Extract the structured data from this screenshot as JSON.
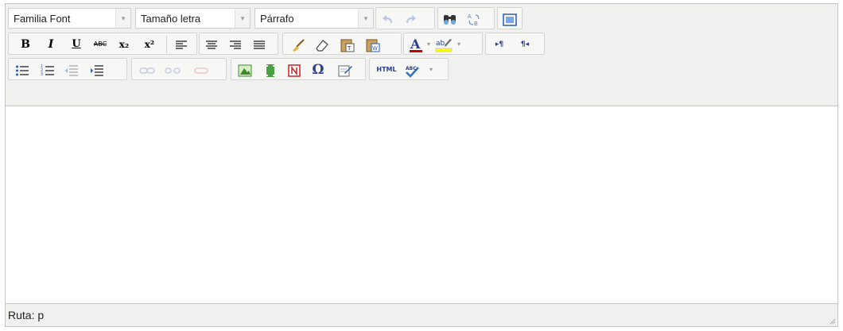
{
  "toolbar": {
    "font_family": {
      "value": "Familia Font"
    },
    "font_size": {
      "value": "Tamaño letra"
    },
    "format": {
      "value": "Párrafo"
    },
    "buttons": {
      "undo": "undo-icon",
      "redo": "redo-icon",
      "find": "find-icon",
      "replace": "replace-icon",
      "fullscreen": "fullscreen-icon",
      "bold": "B",
      "italic": "I",
      "underline": "U",
      "strikethrough": "ABC",
      "subscript": "x₂",
      "superscript": "x²",
      "ltr": "▸¶",
      "rtl": "¶◂",
      "html": "HTML"
    }
  },
  "statusbar": {
    "path": "Ruta: p"
  },
  "colors": {
    "toolbar_bg": "#f0f0ee",
    "border": "#c6c6c6",
    "icon_blue": "#2a5aa8",
    "icon_green": "#3c8c2c",
    "font_color_red": "#cc0000"
  }
}
